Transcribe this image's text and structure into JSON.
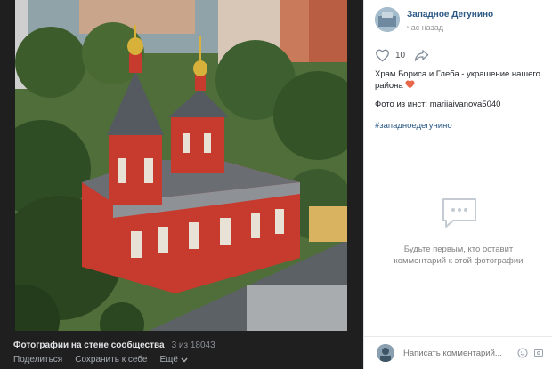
{
  "footer": {
    "title": "Фотографии на стене сообщества",
    "count": "3 из 18043",
    "share": "Поделиться",
    "save": "Сохранить к себе",
    "more": "Ещё"
  },
  "post": {
    "author": "Западное Дегунино",
    "time": "час назад",
    "likes": "10",
    "text": "Храм Бориса и Глеба - украшение нашего района",
    "source": "Фото из инст: mariiaivanova5040",
    "hashtag": "#западноедегунино"
  },
  "comments": {
    "empty": "Будьте первым, кто оставит комментарий к этой фотографии",
    "placeholder": "Написать комментарий..."
  },
  "colors": {
    "link": "#2a5885",
    "church_red": "#c73a2e",
    "heart": "#e8664a"
  }
}
